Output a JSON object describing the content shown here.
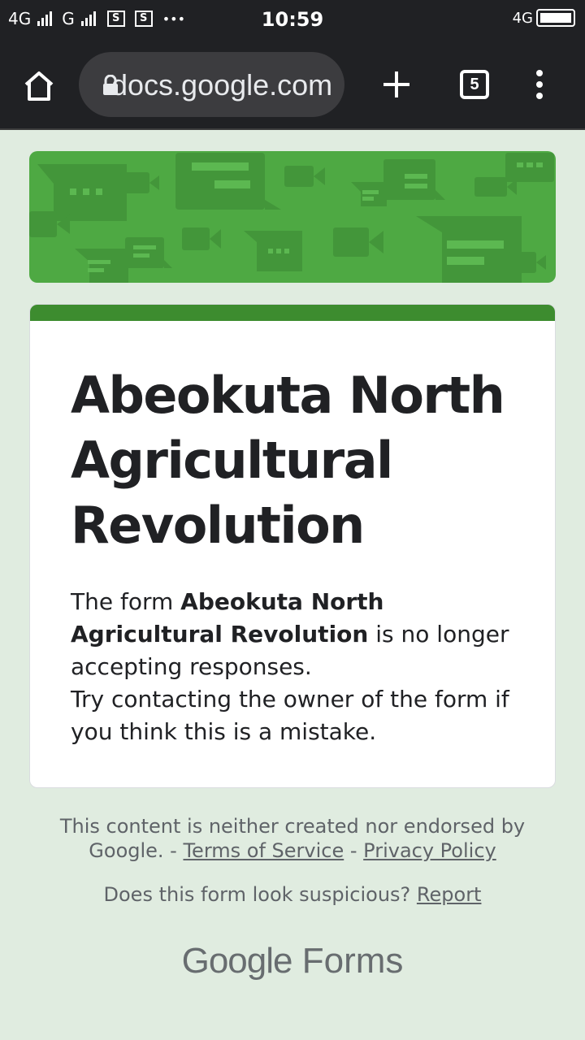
{
  "status_bar": {
    "network_1": "4G",
    "network_2": "G",
    "dots": "•••",
    "time": "10:59",
    "network_right": "4G"
  },
  "browser": {
    "url": "docs.google.com",
    "tab_count": "5"
  },
  "form": {
    "title": "Abeokuta North Agricultural Revolution",
    "msg_prefix": "The form ",
    "msg_bold": "Abeokuta North Agricultural Revolution",
    "msg_suffix": " is no longer accepting responses.",
    "msg_line2": "Try contacting the owner of the form if you think this is a mistake."
  },
  "footer": {
    "disclaimer": "This content is neither created nor endorsed by Google. - ",
    "terms_link": "Terms of Service",
    "separator": " - ",
    "privacy_link": "Privacy Policy",
    "suspicious_text": "Does this form look suspicious? ",
    "report_link": "Report",
    "brand_google": "Google",
    "brand_forms": "Forms"
  },
  "colors": {
    "banner_green": "#4ea943",
    "card_accent": "#3d8c2f",
    "page_bg": "#e0ece0",
    "toolbar_bg": "#202124"
  }
}
